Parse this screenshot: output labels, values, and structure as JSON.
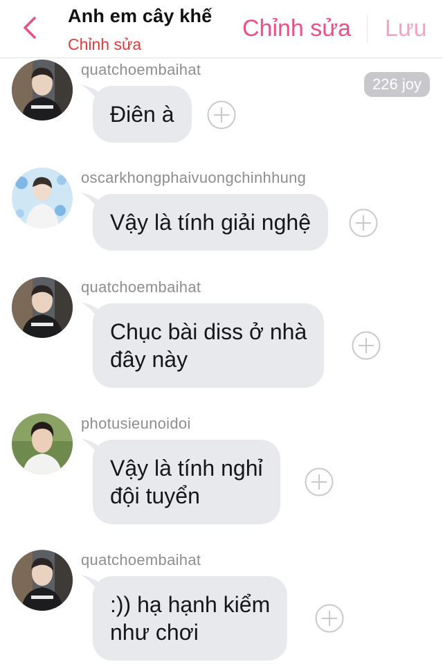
{
  "header": {
    "title": "Anh em cây khế",
    "subtitle": "Chỉnh sửa",
    "edit_label": "Chỉnh sửa",
    "save_label": "Lưu"
  },
  "score_badge": "226 joy",
  "messages": [
    {
      "username": "quatchoembaihat",
      "text": "Điên à"
    },
    {
      "username": "oscarkhongphaivuongchinhhung",
      "text": "Vậy là tính giải nghệ"
    },
    {
      "username": "quatchoembaihat",
      "text_lines": [
        "Chục bài diss ở nhà",
        "đây này"
      ]
    },
    {
      "username": "photusieunoidoi",
      "text_lines": [
        "Vậy là tính nghỉ",
        "đội tuyển"
      ]
    },
    {
      "username": "quatchoembaihat",
      "text_lines": [
        ":)) hạ hạnh kiểm",
        "như chơi"
      ]
    }
  ],
  "colors": {
    "accent": "#ef4f86",
    "accent_light": "#f5a3c2",
    "subtitle": "#e23a3a",
    "bubble": "#e8e9ec",
    "username": "#8e8e8e",
    "badge": "#c8c8cc"
  }
}
